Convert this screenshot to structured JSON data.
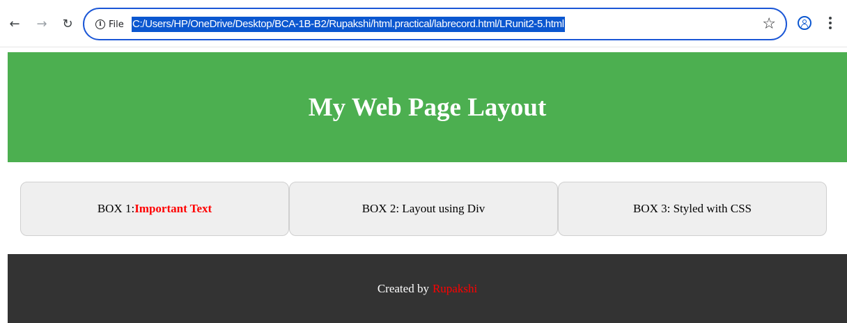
{
  "browser": {
    "chip_label": "File",
    "url": "C:/Users/HP/OneDrive/Desktop/BCA-1B-B2/Rupakshi/html.practical/labrecord.html/LRunit2-5.html",
    "icons": {
      "back": "back-arrow-icon",
      "forward": "forward-arrow-icon",
      "reload": "reload-icon",
      "info": "info-icon",
      "bookmark": "star-icon",
      "profile": "profile-icon",
      "menu": "kebab-menu-icon"
    },
    "accent_color": "#0b57d0"
  },
  "page": {
    "header_title": "My Web Page Layout",
    "header_color": "#4caf50",
    "boxes": [
      {
        "prefix": "BOX 1:",
        "highlight": "Important Text"
      },
      {
        "text": "BOX 2: Layout using Div"
      },
      {
        "text": "BOX 3: Styled with CSS"
      }
    ],
    "footer": {
      "prefix": "Created by",
      "author": "Rupakshi",
      "background": "#333333"
    },
    "highlight_color": "#ff0000"
  }
}
